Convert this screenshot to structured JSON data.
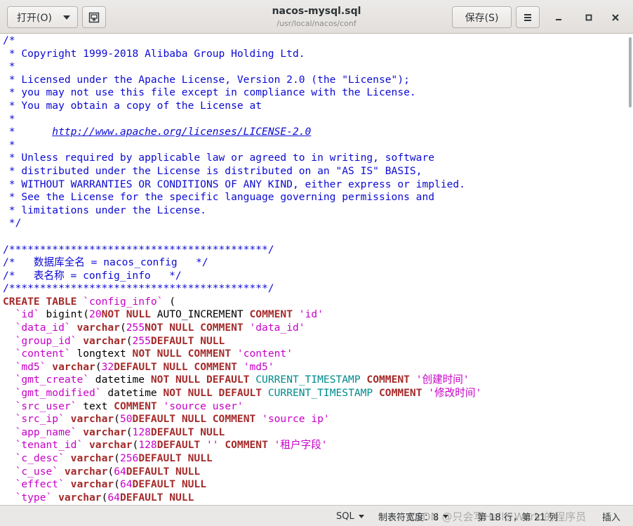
{
  "header": {
    "open_label": "打开(O)",
    "save_label": "保存(S)",
    "title": "nacos-mysql.sql",
    "path": "/usr/local/nacos/conf"
  },
  "editor": {
    "lines": [
      [
        [
          "c",
          "/*"
        ]
      ],
      [
        [
          "c",
          " * Copyright 1999-2018 Alibaba Group Holding Ltd."
        ]
      ],
      [
        [
          "c",
          " *"
        ]
      ],
      [
        [
          "c",
          " * Licensed under the Apache License, Version 2.0 (the \"License\");"
        ]
      ],
      [
        [
          "c",
          " * you may not use this file except in compliance with the License."
        ]
      ],
      [
        [
          "c",
          " * You may obtain a copy of the License at"
        ]
      ],
      [
        [
          "c",
          " *"
        ]
      ],
      [
        [
          "c",
          " *      "
        ],
        [
          "link",
          "http://www.apache.org/licenses/LICENSE-2.0"
        ]
      ],
      [
        [
          "c",
          " *"
        ]
      ],
      [
        [
          "c",
          " * Unless required by applicable law or agreed to in writing, software"
        ]
      ],
      [
        [
          "c",
          " * distributed under the License is distributed on an \"AS IS\" BASIS,"
        ]
      ],
      [
        [
          "c",
          " * WITHOUT WARRANTIES OR CONDITIONS OF ANY KIND, either express or implied."
        ]
      ],
      [
        [
          "c",
          " * See the License for the specific language governing permissions and"
        ]
      ],
      [
        [
          "c",
          " * limitations under the License."
        ]
      ],
      [
        [
          "c",
          " */"
        ]
      ],
      [
        [
          "",
          ""
        ]
      ],
      [
        [
          "c",
          "/******************************************/"
        ]
      ],
      [
        [
          "c",
          "/*   数据库全名 = nacos_config   */"
        ]
      ],
      [
        [
          "c",
          "/*   表名称 = config_info   */"
        ]
      ],
      [
        [
          "c",
          "/******************************************/"
        ]
      ],
      [
        [
          "kw",
          "CREATE TABLE "
        ],
        [
          "id",
          "`config_info`"
        ],
        [
          "",
          " ("
        ]
      ],
      [
        [
          "",
          "  "
        ],
        [
          "id",
          "`id`"
        ],
        [
          "",
          " bigint("
        ],
        [
          "num",
          "20"
        ],
        [
          ") "
        ],
        [
          "kw",
          "NOT NULL"
        ],
        [
          "",
          " AUTO_INCREMENT "
        ],
        [
          "kw",
          "COMMENT "
        ],
        [
          "str",
          "'id'"
        ],
        [
          ","
        ]
      ],
      [
        [
          "",
          "  "
        ],
        [
          "id",
          "`data_id`"
        ],
        [
          "",
          ""
        ],
        [
          "kw",
          " varchar"
        ],
        [
          "",
          "("
        ],
        [
          "num",
          "255"
        ],
        [
          ") "
        ],
        [
          "kw",
          "NOT NULL COMMENT "
        ],
        [
          "str",
          "'data_id'"
        ],
        [
          ","
        ]
      ],
      [
        [
          "",
          "  "
        ],
        [
          "id",
          "`group_id`"
        ],
        [
          "kw",
          " varchar"
        ],
        [
          "",
          "("
        ],
        [
          "num",
          "255"
        ],
        [
          ") "
        ],
        [
          "kw",
          "DEFAULT NULL"
        ],
        [
          ","
        ]
      ],
      [
        [
          "",
          "  "
        ],
        [
          "id",
          "`content`"
        ],
        [
          "",
          " longtext "
        ],
        [
          "kw",
          "NOT NULL COMMENT "
        ],
        [
          "str",
          "'content'"
        ],
        [
          ","
        ]
      ],
      [
        [
          "",
          "  "
        ],
        [
          "id",
          "`md5`"
        ],
        [
          "kw",
          " varchar"
        ],
        [
          "",
          "("
        ],
        [
          "num",
          "32"
        ],
        [
          ") "
        ],
        [
          "kw",
          "DEFAULT NULL COMMENT "
        ],
        [
          "str",
          "'md5'"
        ],
        [
          ","
        ]
      ],
      [
        [
          "",
          "  "
        ],
        [
          "id",
          "`gmt_create`"
        ],
        [
          "",
          " datetime "
        ],
        [
          "kw",
          "NOT NULL DEFAULT "
        ],
        [
          "fn",
          "CURRENT_TIMESTAMP"
        ],
        [
          "kw",
          " COMMENT "
        ],
        [
          "str",
          "'创建时间'"
        ],
        [
          ","
        ]
      ],
      [
        [
          "",
          "  "
        ],
        [
          "id",
          "`gmt_modified`"
        ],
        [
          "",
          " datetime "
        ],
        [
          "kw",
          "NOT NULL DEFAULT "
        ],
        [
          "fn",
          "CURRENT_TIMESTAMP"
        ],
        [
          "kw",
          " COMMENT "
        ],
        [
          "str",
          "'修改时间'"
        ],
        [
          ","
        ]
      ],
      [
        [
          "",
          "  "
        ],
        [
          "id",
          "`src_user`"
        ],
        [
          "",
          " text "
        ],
        [
          "kw",
          "COMMENT "
        ],
        [
          "str",
          "'source user'"
        ],
        [
          ","
        ]
      ],
      [
        [
          "",
          "  "
        ],
        [
          "id",
          "`src_ip`"
        ],
        [
          "kw",
          " varchar"
        ],
        [
          "",
          "("
        ],
        [
          "num",
          "50"
        ],
        [
          ") "
        ],
        [
          "kw",
          "DEFAULT NULL COMMENT "
        ],
        [
          "str",
          "'source ip'"
        ],
        [
          ","
        ]
      ],
      [
        [
          "",
          "  "
        ],
        [
          "id",
          "`app_name`"
        ],
        [
          "kw",
          " varchar"
        ],
        [
          "",
          "("
        ],
        [
          "num",
          "128"
        ],
        [
          ") "
        ],
        [
          "kw",
          "DEFAULT NULL"
        ],
        [
          ","
        ]
      ],
      [
        [
          "",
          "  "
        ],
        [
          "id",
          "`tenant_id`"
        ],
        [
          "kw",
          " varchar"
        ],
        [
          "",
          "("
        ],
        [
          "num",
          "128"
        ],
        [
          ") "
        ],
        [
          "kw",
          "DEFAULT "
        ],
        [
          "str",
          "''"
        ],
        [
          "kw",
          " COMMENT "
        ],
        [
          "str",
          "'租户字段'"
        ],
        [
          ","
        ]
      ],
      [
        [
          "",
          "  "
        ],
        [
          "id",
          "`c_desc`"
        ],
        [
          "kw",
          " varchar"
        ],
        [
          "",
          "("
        ],
        [
          "num",
          "256"
        ],
        [
          ") "
        ],
        [
          "kw",
          "DEFAULT NULL"
        ],
        [
          ","
        ]
      ],
      [
        [
          "",
          "  "
        ],
        [
          "id",
          "`c_use`"
        ],
        [
          "kw",
          " varchar"
        ],
        [
          "",
          "("
        ],
        [
          "num",
          "64"
        ],
        [
          ") "
        ],
        [
          "kw",
          "DEFAULT NULL"
        ],
        [
          ","
        ]
      ],
      [
        [
          "",
          "  "
        ],
        [
          "id",
          "`effect`"
        ],
        [
          "kw",
          " varchar"
        ],
        [
          "",
          "("
        ],
        [
          "num",
          "64"
        ],
        [
          ") "
        ],
        [
          "kw",
          "DEFAULT NULL"
        ],
        [
          ","
        ]
      ],
      [
        [
          "",
          "  "
        ],
        [
          "id",
          "`type`"
        ],
        [
          "kw",
          " varchar"
        ],
        [
          "",
          "("
        ],
        [
          "num",
          "64"
        ],
        [
          ") "
        ],
        [
          "kw",
          "DEFAULT NULL"
        ],
        [
          ","
        ]
      ]
    ]
  },
  "status": {
    "language": "SQL",
    "tab_width": "制表符宽度：8",
    "position": "第 18 行，第 21 列",
    "mode": "插入",
    "watermark": "CSDN @只会写Hello World的程序员"
  },
  "colors": {
    "comment": "#0c0ad2",
    "keyword": "#a52a2a",
    "identifier": "#c800c8",
    "function": "#008a8c"
  },
  "icons": {
    "open_dropdown": "chevron-down-icon",
    "new_document": "new-document-icon",
    "hamburger_menu": "menu-icon",
    "minimize": "minimize-icon",
    "maximize": "maximize-icon",
    "close": "close-icon"
  }
}
